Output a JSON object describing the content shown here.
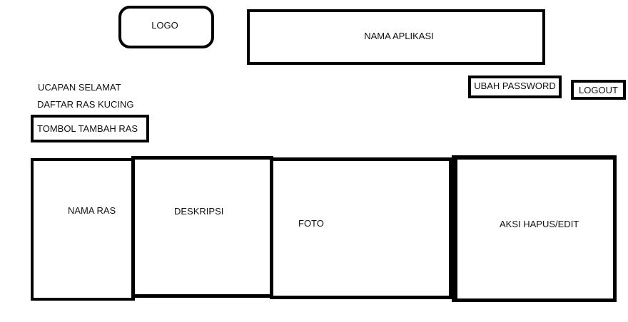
{
  "header": {
    "logo_label": "LOGO",
    "app_name": "NAMA APLIKASI"
  },
  "user_actions": {
    "change_password_label": "UBAH PASSWORD",
    "logout_label": "LOGOUT"
  },
  "content": {
    "greeting": "UCAPAN SELAMAT",
    "list_title": "DAFTAR RAS KUCING",
    "add_button_label": "TOMBOL TAMBAH RAS"
  },
  "table": {
    "columns": [
      {
        "label": "NAMA RAS"
      },
      {
        "label": "DESKRIPSI"
      },
      {
        "label": "FOTO"
      },
      {
        "label": "AKSI HAPUS/EDIT"
      }
    ]
  }
}
